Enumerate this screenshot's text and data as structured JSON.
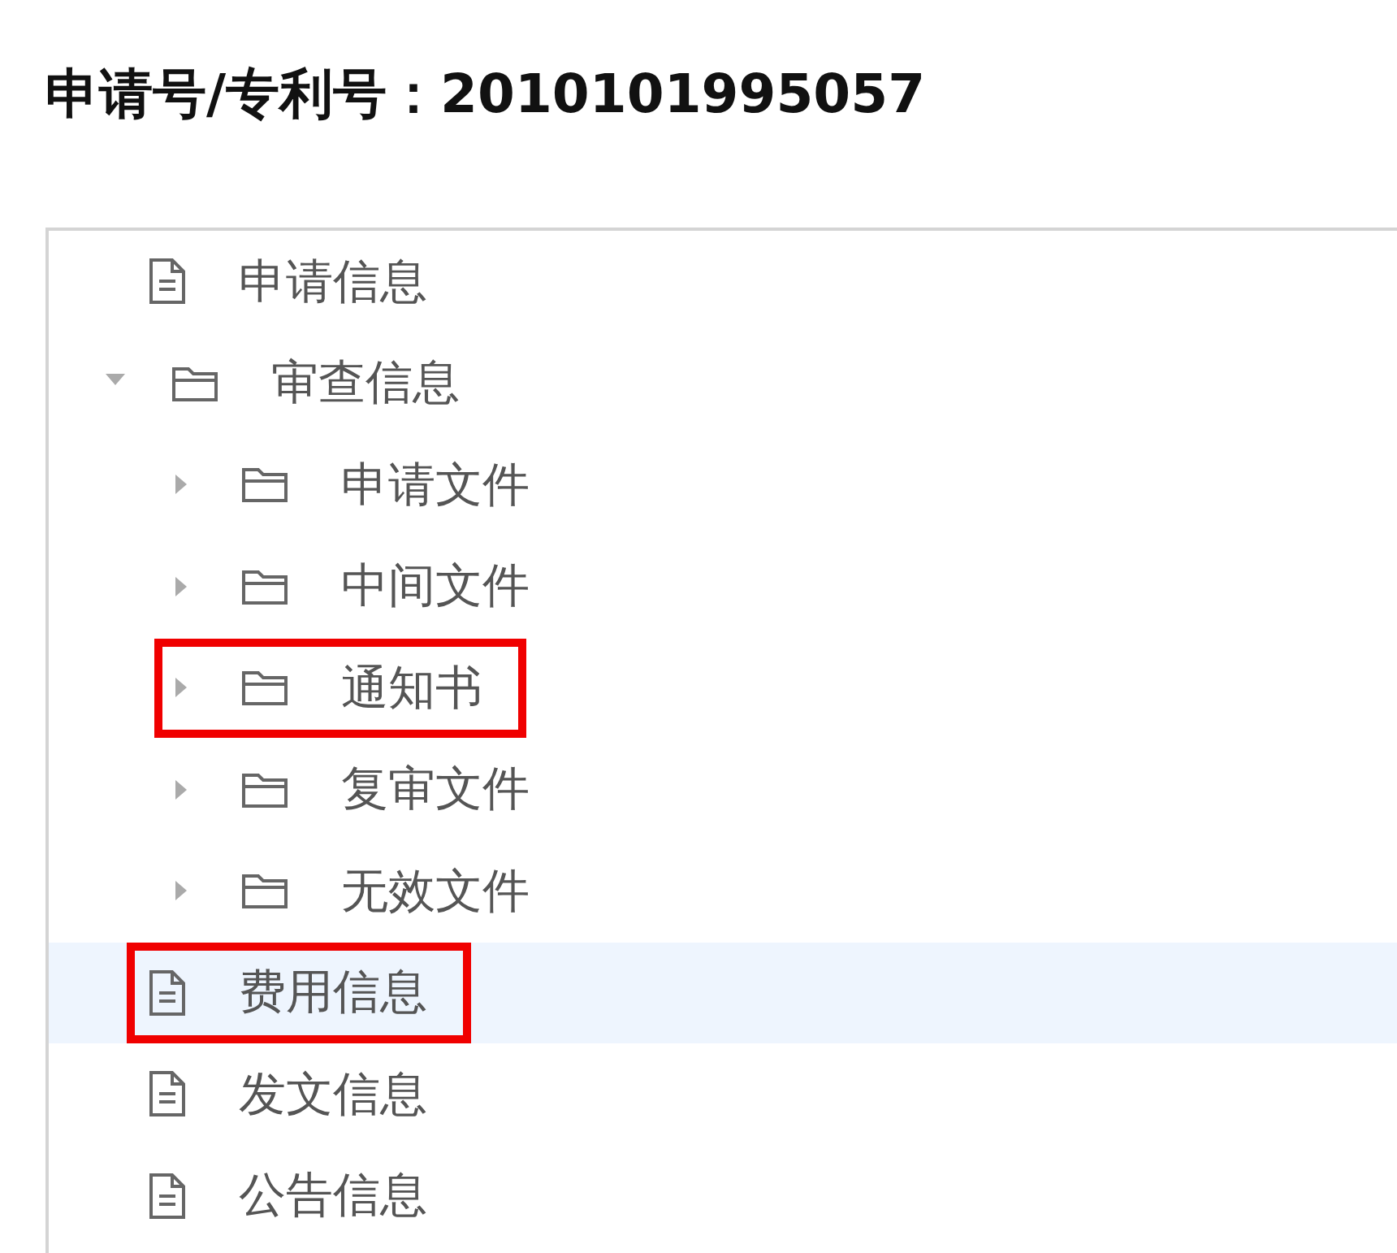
{
  "title": "申请号/专利号：2010101995057",
  "tree": [
    {
      "label": "申请信息",
      "kind": "file",
      "selected": false,
      "highlighted": false
    },
    {
      "label": "审查信息",
      "kind": "folder",
      "expanded": true,
      "selected": false,
      "highlighted": false,
      "children": [
        {
          "label": "申请文件",
          "kind": "folder",
          "expanded": false,
          "selected": false,
          "highlighted": false
        },
        {
          "label": "中间文件",
          "kind": "folder",
          "expanded": false,
          "selected": false,
          "highlighted": false
        },
        {
          "label": "通知书",
          "kind": "folder",
          "expanded": false,
          "selected": false,
          "highlighted": true
        },
        {
          "label": "复审文件",
          "kind": "folder",
          "expanded": false,
          "selected": false,
          "highlighted": false
        },
        {
          "label": "无效文件",
          "kind": "folder",
          "expanded": false,
          "selected": false,
          "highlighted": false
        }
      ]
    },
    {
      "label": "费用信息",
      "kind": "file",
      "selected": true,
      "highlighted": true
    },
    {
      "label": "发文信息",
      "kind": "file",
      "selected": false,
      "highlighted": false
    },
    {
      "label": "公告信息",
      "kind": "file",
      "selected": false,
      "highlighted": false
    }
  ]
}
